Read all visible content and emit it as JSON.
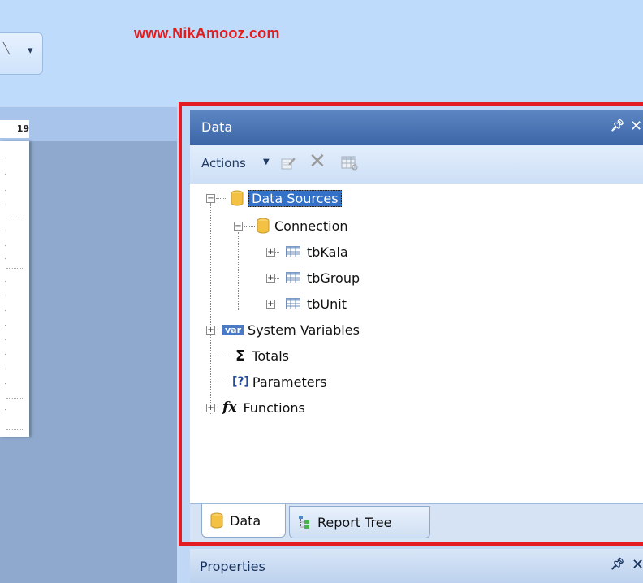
{
  "watermark": "www.NikAmooz.com",
  "ruler": {
    "number": "19"
  },
  "data_panel": {
    "title": "Data",
    "pin": "↑",
    "close": "✕",
    "toolbar": {
      "actions_label": "Actions",
      "actions_arrow": "▼",
      "delete_glyph": "✕"
    },
    "tree": {
      "data_sources": "Data Sources",
      "connection": "Connection",
      "tables": [
        "tbKala",
        "tbGroup",
        "tbUnit"
      ],
      "var_badge": "var",
      "system_variables": "System Variables",
      "totals": "Totals",
      "parameters": "Parameters",
      "functions": "Functions",
      "sigma": "Σ",
      "param_glyph": "[?]",
      "fx_glyph": "fx",
      "expand": "+",
      "collapse": "−"
    },
    "tabs": {
      "data": "Data",
      "report_tree": "Report Tree"
    }
  },
  "properties_panel": {
    "title": "Properties",
    "pin": "↑",
    "close": "✕"
  },
  "colors": {
    "accent": "#3d66a8",
    "highlight_frame": "#e31b23",
    "watermark": "#e31d1d"
  }
}
